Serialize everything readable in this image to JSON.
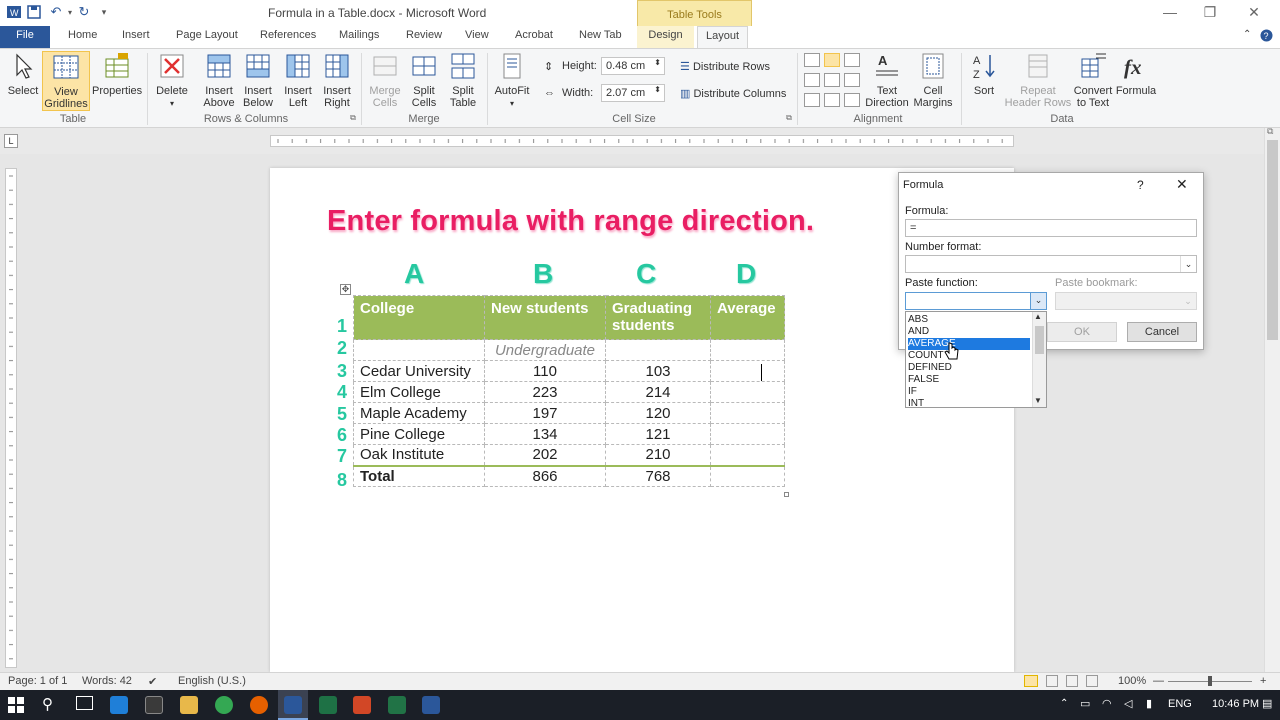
{
  "window": {
    "title": "Formula in a Table.docx - Microsoft Word",
    "context_tab": "Table Tools"
  },
  "tabs": [
    "File",
    "Home",
    "Insert",
    "Page Layout",
    "References",
    "Mailings",
    "Review",
    "View",
    "Acrobat",
    "New Tab",
    "Design",
    "Layout"
  ],
  "ribbon": {
    "table_group": {
      "label": "Table",
      "select": "Select",
      "view_gridlines_1": "View",
      "view_gridlines_2": "Gridlines",
      "properties": "Properties"
    },
    "rows_group": {
      "label": "Rows & Columns",
      "delete": "Delete",
      "insert_above_1": "Insert",
      "insert_above_2": "Above",
      "insert_below_1": "Insert",
      "insert_below_2": "Below",
      "insert_left_1": "Insert",
      "insert_left_2": "Left",
      "insert_right_1": "Insert",
      "insert_right_2": "Right"
    },
    "merge_group": {
      "label": "Merge",
      "merge_cells_1": "Merge",
      "merge_cells_2": "Cells",
      "split_cells_1": "Split",
      "split_cells_2": "Cells",
      "split_table_1": "Split",
      "split_table_2": "Table"
    },
    "cell_size_group": {
      "label": "Cell Size",
      "autofit": "AutoFit",
      "height_label": "Height:",
      "height_value": "0.48 cm",
      "width_label": "Width:",
      "width_value": "2.07 cm",
      "distribute_rows": "Distribute Rows",
      "distribute_columns": "Distribute Columns"
    },
    "alignment_group": {
      "label": "Alignment",
      "text_direction_1": "Text",
      "text_direction_2": "Direction",
      "cell_margins_1": "Cell",
      "cell_margins_2": "Margins"
    },
    "data_group": {
      "label": "Data",
      "sort": "Sort",
      "repeat_1": "Repeat",
      "repeat_2": "Header Rows",
      "convert_1": "Convert",
      "convert_2": "to Text",
      "formula": "Formula"
    }
  },
  "document": {
    "heading": "Enter formula with range direction.",
    "column_letters": [
      "A",
      "B",
      "C",
      "D"
    ],
    "row_numbers": [
      "1",
      "2",
      "3",
      "4",
      "5",
      "6",
      "7",
      "8"
    ],
    "header": {
      "college": "College",
      "new_students": "New students",
      "graduating_1": "Graduating",
      "graduating_2": "students",
      "average": "Average"
    },
    "subheader": "Undergraduate",
    "rows": [
      {
        "college": "Cedar University",
        "new": "110",
        "grad": "103"
      },
      {
        "college": "Elm College",
        "new": "223",
        "grad": "214"
      },
      {
        "college": "Maple Academy",
        "new": "197",
        "grad": "120"
      },
      {
        "college": "Pine College",
        "new": "134",
        "grad": "121"
      },
      {
        "college": "Oak Institute",
        "new": "202",
        "grad": "210"
      }
    ],
    "total": {
      "label": "Total",
      "new": "866",
      "grad": "768"
    }
  },
  "dialog": {
    "title": "Formula",
    "help": "?",
    "formula_label": "Formula:",
    "formula_value": "=",
    "number_format_label": "Number format:",
    "paste_function_label": "Paste function:",
    "paste_bookmark_label": "Paste bookmark:",
    "ok": "OK",
    "cancel": "Cancel",
    "functions": [
      "ABS",
      "AND",
      "AVERAGE",
      "COUNT",
      "DEFINED",
      "FALSE",
      "IF",
      "INT"
    ],
    "selected_function": "AVERAGE"
  },
  "status": {
    "page": "Page: 1 of 1",
    "words": "Words: 42",
    "language": "English (U.S.)",
    "zoom": "100%"
  },
  "taskbar": {
    "language": "ENG",
    "time": "10:46 PM"
  },
  "colors": {
    "word_blue": "#2b579a",
    "table_header": "#9bbb59",
    "heading_pink": "#e91e63",
    "label_teal": "#26c8a0",
    "selection_blue": "#1e7ae0"
  }
}
